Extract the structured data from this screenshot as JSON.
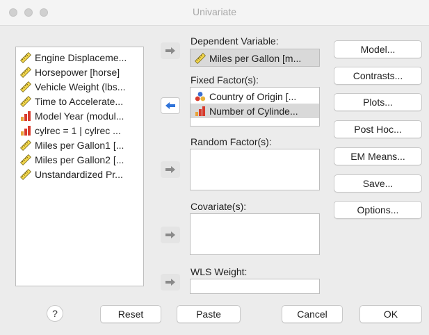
{
  "window": {
    "title": "Univariate"
  },
  "variables": {
    "items": [
      {
        "label": "Engine Displaceme...",
        "icon": "scale-ruler-icon"
      },
      {
        "label": "Horsepower [horse]",
        "icon": "scale-ruler-icon"
      },
      {
        "label": "Vehicle Weight (lbs...",
        "icon": "scale-ruler-icon"
      },
      {
        "label": "Time to Accelerate...",
        "icon": "scale-ruler-icon"
      },
      {
        "label": "Model Year (modul...",
        "icon": "ordinal-bars-icon"
      },
      {
        "label": "cylrec = 1 | cylrec ...",
        "icon": "ordinal-bars-icon"
      },
      {
        "label": "Miles per Gallon1 [...",
        "icon": "scale-ruler-icon"
      },
      {
        "label": "Miles per Gallon2 [...",
        "icon": "scale-ruler-icon"
      },
      {
        "label": "Unstandardized Pr...",
        "icon": "scale-ruler-icon"
      }
    ]
  },
  "dependent": {
    "label": "Dependent Variable:",
    "value": "Miles per Gallon [m..."
  },
  "fixed": {
    "label": "Fixed Factor(s):",
    "items": [
      {
        "label": "Country of Origin [...",
        "icon": "nominal-circles-icon"
      },
      {
        "label": "Number of Cylinde...",
        "icon": "ordinal-bars-icon"
      }
    ]
  },
  "random": {
    "label": "Random Factor(s):"
  },
  "covariate": {
    "label": "Covariate(s):"
  },
  "wls": {
    "label": "WLS Weight:"
  },
  "side_buttons": {
    "model": "Model...",
    "contrasts": "Contrasts...",
    "plots": "Plots...",
    "posthoc": "Post Hoc...",
    "emmeans": "EM Means...",
    "save": "Save...",
    "options": "Options..."
  },
  "bottom_buttons": {
    "help": "?",
    "reset": "Reset",
    "paste": "Paste",
    "cancel": "Cancel",
    "ok": "OK"
  },
  "colors": {
    "arrow_active": "#2f73d9",
    "arrow_dim": "#8a8a8a",
    "selection": "#d9d9d9"
  }
}
